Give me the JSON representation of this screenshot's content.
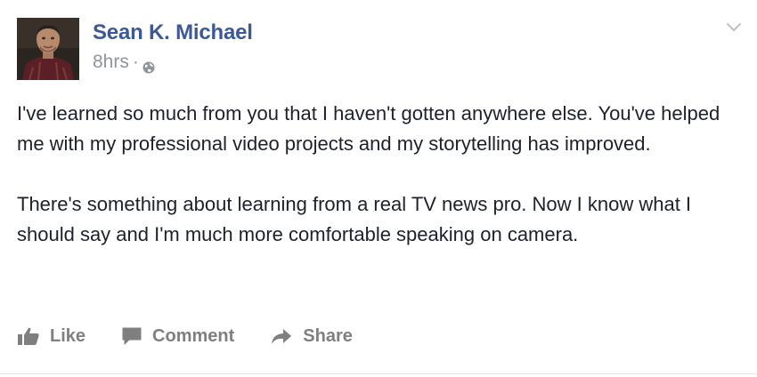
{
  "post": {
    "author": "Sean K. Michael",
    "timestamp": "8hrs",
    "separator": "·",
    "privacy_icon": "globe-icon",
    "menu_icon": "chevron-down-icon",
    "paragraphs": [
      "I've learned so much from you that I haven't gotten anywhere else. You've helped me with my professional video projects and my storytelling has improved.",
      "There's something about learning from a real TV news pro. Now I know what I should say and I'm much more comfortable speaking on camera."
    ]
  },
  "actions": {
    "like_label": "Like",
    "comment_label": "Comment",
    "share_label": "Share"
  },
  "colors": {
    "author_link": "#3b5998",
    "meta_text": "#90949c",
    "body_text": "#1d2129",
    "action_text": "#7f7f7f"
  }
}
